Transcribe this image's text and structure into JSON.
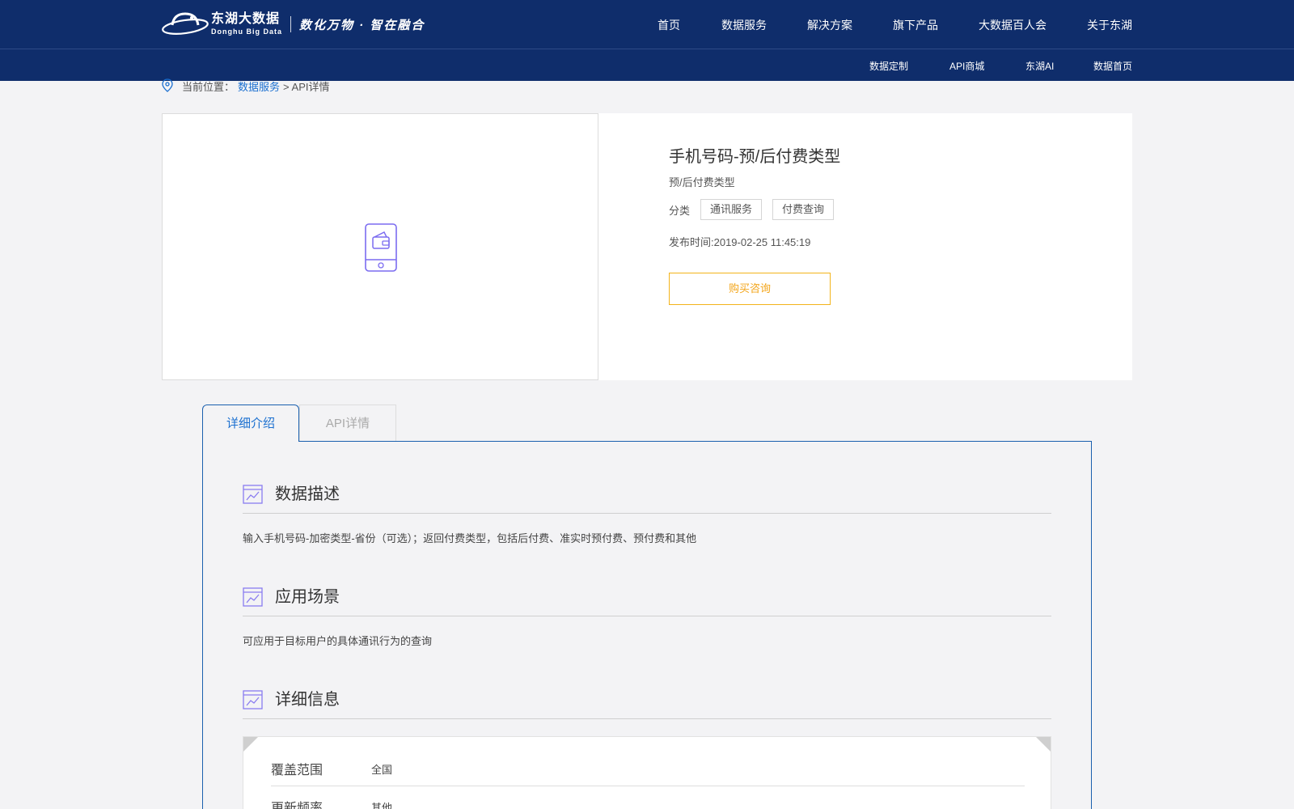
{
  "header": {
    "logo_cn": "东湖大数据",
    "logo_en": "Donghu Big Data",
    "slogan": "数化万物 · 智在融合",
    "nav": [
      "首页",
      "数据服务",
      "解决方案",
      "旗下产品",
      "大数据百人会",
      "关于东湖"
    ],
    "subnav": [
      "数据定制",
      "API商城",
      "东湖AI",
      "数据首页"
    ]
  },
  "breadcrumb": {
    "prefix": "当前位置：",
    "link": "数据服务",
    "sep_current": "> API详情"
  },
  "product": {
    "title": "手机号码-预/后付费类型",
    "subtitle": "预/后付费类型",
    "category_label": "分类",
    "tags": [
      "通讯服务",
      "付费查询"
    ],
    "publish_time": "发布时间:2019-02-25 11:45:19",
    "buy_button": "购买咨询"
  },
  "tabs": {
    "active": "详细介绍",
    "inactive": "API详情"
  },
  "sections": {
    "desc_title": "数据描述",
    "desc_text": "输入手机号码-加密类型-省份（可选）；返回付费类型，包括后付费、准实时预付费、预付费和其他",
    "scene_title": "应用场景",
    "scene_text": "可应用于目标用户的具体通讯行为的查询",
    "detail_title": "详细信息"
  },
  "details": [
    {
      "label": "覆盖范围",
      "value": "全国"
    },
    {
      "label": "更新频率",
      "value": "其他"
    }
  ],
  "colors": {
    "header_bg": "#0f2d6b",
    "link_blue": "#1a6fd0",
    "buy_orange": "#f3a51a",
    "icon_purple": "#7b6cf0"
  }
}
